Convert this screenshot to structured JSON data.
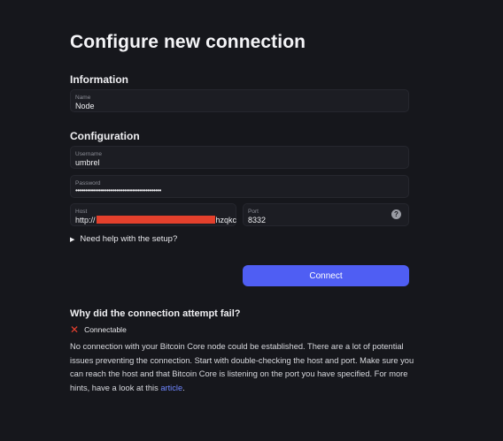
{
  "page": {
    "title": "Configure new connection"
  },
  "information": {
    "heading": "Information",
    "name": {
      "label": "Name",
      "value": "Node"
    }
  },
  "configuration": {
    "heading": "Configuration",
    "username": {
      "label": "Username",
      "value": "umbrel"
    },
    "password": {
      "label": "Password",
      "value": "••••••••••••••••••••••••••••••••••••••••••••"
    },
    "host": {
      "label": "Host",
      "value_prefix": "http://",
      "value_suffix": "hzqkc"
    },
    "port": {
      "label": "Port",
      "value": "8332",
      "help_icon": "?"
    }
  },
  "setup_help": {
    "label": "Need help with the setup?"
  },
  "connect_button": {
    "label": "Connect",
    "color": "#4f5ef3"
  },
  "failure": {
    "heading": "Why did the connection attempt fail?",
    "check": {
      "label": "Connectable",
      "status": "failed",
      "color": "#e8402f"
    },
    "message": "No connection with your Bitcoin Core node could be established. There are a lot of potential issues preventing the connection. Start with double-checking the host and port. Make sure you can reach the host and that Bitcoin Core is listening on the port you have specified. For more hints, have a look at this ",
    "link_text": "article",
    "message_end": "."
  }
}
